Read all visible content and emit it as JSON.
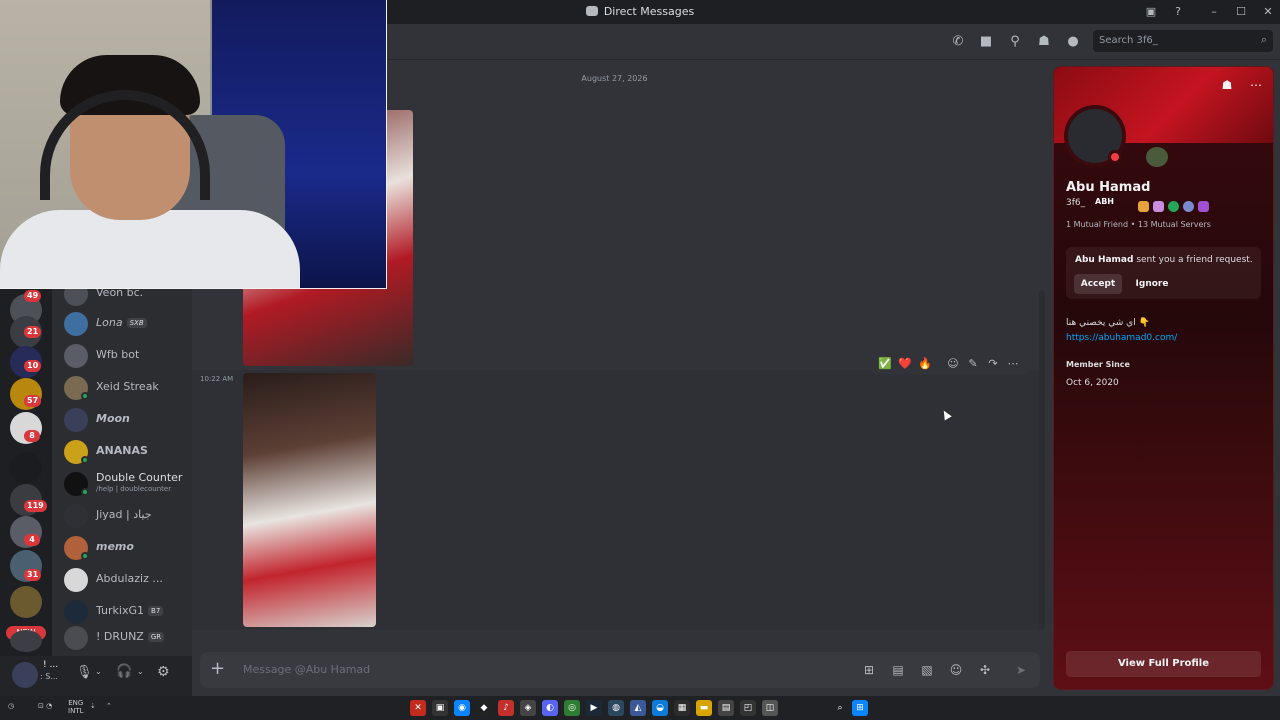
{
  "window": {
    "title": "Direct Messages"
  },
  "header": {
    "search_placeholder": "Search 3f6_",
    "icons": [
      "phone-icon",
      "video-icon",
      "pin-icon",
      "add-member-icon",
      "user-profile-icon",
      "inbox-icon",
      "help-icon"
    ]
  },
  "guild_badges": [
    "49",
    "21",
    "10",
    "57",
    "8",
    "119",
    "4",
    "31"
  ],
  "new_badge": "NEW",
  "dm_list": [
    {
      "name": "Veon bc.",
      "tag": "",
      "sub": ""
    },
    {
      "name": "Lona",
      "tag": "SXB",
      "sub": ""
    },
    {
      "name": "Wfb bot",
      "tag": "",
      "sub": ""
    },
    {
      "name": "Xeid Streak",
      "tag": "",
      "sub": ""
    },
    {
      "name": "Moon",
      "tag": "",
      "sub": ""
    },
    {
      "name": "ANANAS",
      "tag": "",
      "sub": ""
    },
    {
      "name": "Double Counter",
      "tag": "",
      "sub": "/help | doublecounter"
    },
    {
      "name": "Jiyad | جياد",
      "tag": "",
      "sub": ""
    },
    {
      "name": "memo",
      "tag": "",
      "sub": ""
    },
    {
      "name": "Abdulaziz ...",
      "tag": "",
      "sub": ""
    },
    {
      "name": "TurkixG1",
      "tag": "B7",
      "sub": ""
    },
    {
      "name": "! DRUNZ",
      "tag": "GR",
      "sub": ""
    }
  ],
  "user_panel": {
    "name": "! ...",
    "status": ": S..."
  },
  "chat": {
    "date_divider": "August 27, 2026",
    "message_time": "10:22 AM",
    "composer_placeholder": "Message @Abu Hamad"
  },
  "reactions": [
    "✅",
    "❤️",
    "🔥"
  ],
  "profile": {
    "display_name": "Abu Hamad",
    "username": "3f6_",
    "guild_tag": "ABH",
    "mutual_friends": "1 Mutual Friend",
    "separator": "•",
    "mutual_servers": "13 Mutual Servers",
    "request_name": "Abu Hamad",
    "request_text": " sent you a friend request.",
    "accept_label": "Accept",
    "ignore_label": "Ignore",
    "bio": "اي شي يخصني هنا 👇",
    "link": "https://abuhamad0.com/",
    "member_since_label": "Member Since",
    "member_since_date": "Oct 6, 2020",
    "full_profile_label": "View Full Profile"
  },
  "colors": {
    "accent_red": "#da373c",
    "link_blue": "#00a8fc",
    "profile_banner": "#c41420"
  },
  "taskbar": {
    "lang": "ENG",
    "layout": "INTL"
  }
}
